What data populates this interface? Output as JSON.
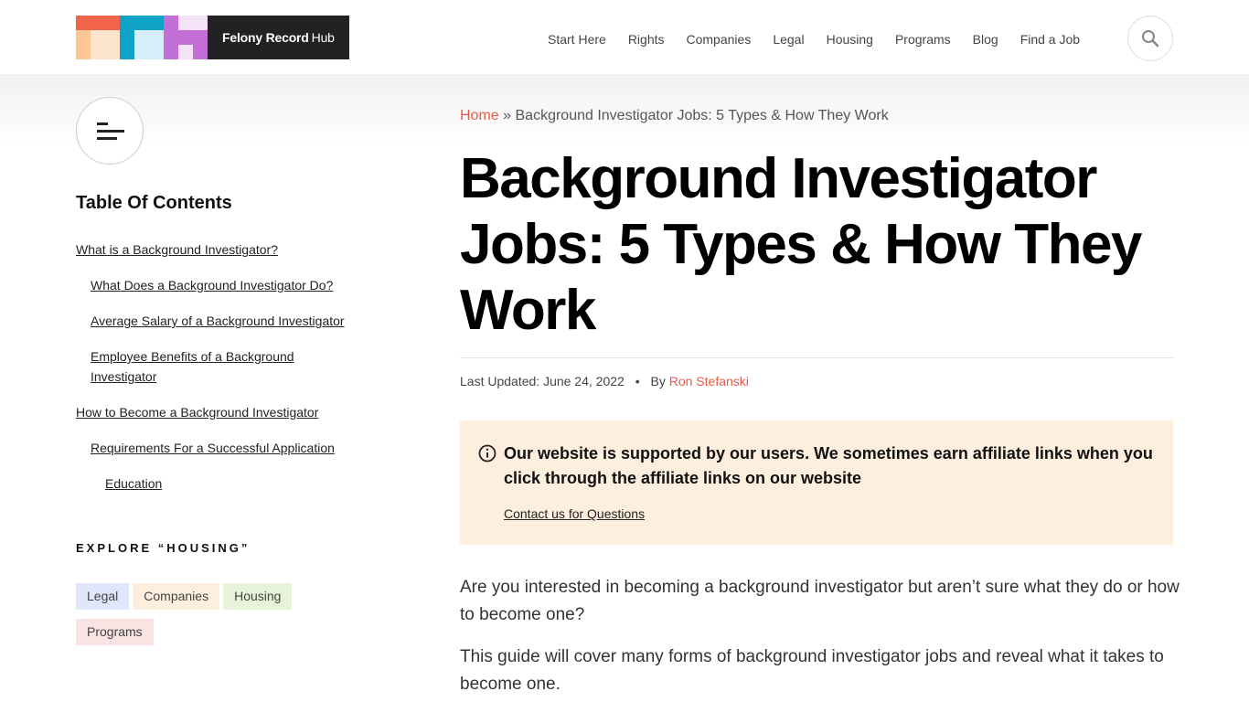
{
  "logo": {
    "brand_bold": "Felony Record",
    "brand_light": "Hub",
    "colors": [
      "#f26449",
      "#0fa3c7",
      "#c36fd6",
      "#fbc795",
      "#d6eef9",
      "#f4e3f7"
    ]
  },
  "nav": {
    "items": [
      "Start Here",
      "Rights",
      "Companies",
      "Legal",
      "Housing",
      "Programs",
      "Blog",
      "Find a Job"
    ],
    "search_icon": "search-icon"
  },
  "sidebar": {
    "menu_icon": "menu-icon",
    "toc_title": "Table Of Contents",
    "toc": [
      {
        "label": "What is a Background Investigator?",
        "level": 1
      },
      {
        "label": "What Does a Background Investigator Do?",
        "level": 2
      },
      {
        "label": "Average Salary of a Background Investigator",
        "level": 2
      },
      {
        "label": "Employee Benefits of a Background Investigator",
        "level": 2
      },
      {
        "label": "How to Become a Background Investigator",
        "level": 1
      },
      {
        "label": "Requirements For a Successful Application",
        "level": 2
      },
      {
        "label": "Education",
        "level": 3
      }
    ],
    "explore_title": "EXPLORE “HOUSING”",
    "tags": [
      {
        "label": "Legal",
        "color": "#e0e6fb"
      },
      {
        "label": "Companies",
        "color": "#fdeede"
      },
      {
        "label": "Housing",
        "color": "#e6f3d9"
      },
      {
        "label": "Programs",
        "color": "#fae3e3"
      }
    ]
  },
  "article": {
    "breadcrumb_home": "Home",
    "breadcrumb_sep": "»",
    "breadcrumb_current": "Background Investigator Jobs: 5 Types & How They Work",
    "title": "Background Investigator Jobs: 5 Types & How They Work",
    "updated_label": "Last Updated:",
    "updated_date": "June 24, 2022",
    "by_label": "By",
    "author": "Ron Stefanski",
    "notice_text": "Our website is supported by our users. We sometimes earn affiliate links when you click through the affiliate links on our website",
    "notice_link": "Contact us for Questions",
    "paragraphs": [
      "Are you interested in becoming a background investigator but aren’t sure what they do or how to become one?",
      "This guide will cover many forms of background investigator jobs and reveal what it takes to become one."
    ],
    "accent": "#e8594a"
  }
}
